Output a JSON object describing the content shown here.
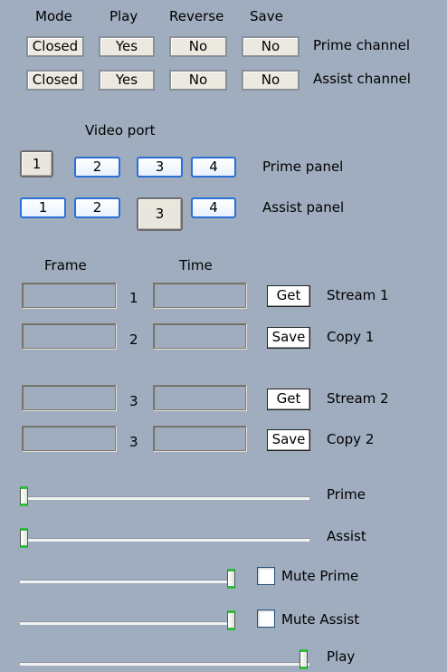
{
  "headers": {
    "mode": "Mode",
    "play": "Play",
    "reverse": "Reverse",
    "save": "Save"
  },
  "channels": [
    {
      "mode": "Closed",
      "play": "Yes",
      "reverse": "No",
      "save": "No",
      "label": "Prime channel"
    },
    {
      "mode": "Closed",
      "play": "Yes",
      "reverse": "No",
      "save": "No",
      "label": "Assist channel"
    }
  ],
  "video_port": {
    "title": "Video port",
    "panels": [
      {
        "label": "Prime panel",
        "ports": [
          "1",
          "2",
          "3",
          "4"
        ],
        "selected": "1"
      },
      {
        "label": "Assist panel",
        "ports": [
          "1",
          "2",
          "3",
          "4"
        ],
        "selected": "3"
      }
    ]
  },
  "frame_header": "Frame",
  "time_header": "Time",
  "streams": [
    {
      "index": "1",
      "button": "Get",
      "label": "Stream 1"
    },
    {
      "index": "2",
      "button": "Save",
      "label": "Copy 1"
    },
    {
      "index": "3",
      "button": "Get",
      "label": "Stream 2"
    },
    {
      "index": "3",
      "button": "Save",
      "label": "Copy 2"
    }
  ],
  "sliders": {
    "prime": {
      "label": "Prime",
      "value": 0.0
    },
    "assist": {
      "label": "Assist",
      "value": 0.0
    },
    "mute_prime_volume": {
      "value": 1.0,
      "checkbox_label": "Mute Prime",
      "checked": false
    },
    "mute_assist_volume": {
      "value": 1.0,
      "checkbox_label": "Mute Assist",
      "checked": false
    },
    "play": {
      "label": "Play",
      "value": 1.0
    }
  },
  "colors": {
    "background": "#9fadbf",
    "port_border": "#2a6fd6",
    "slider_accent": "#2fbf3a"
  }
}
